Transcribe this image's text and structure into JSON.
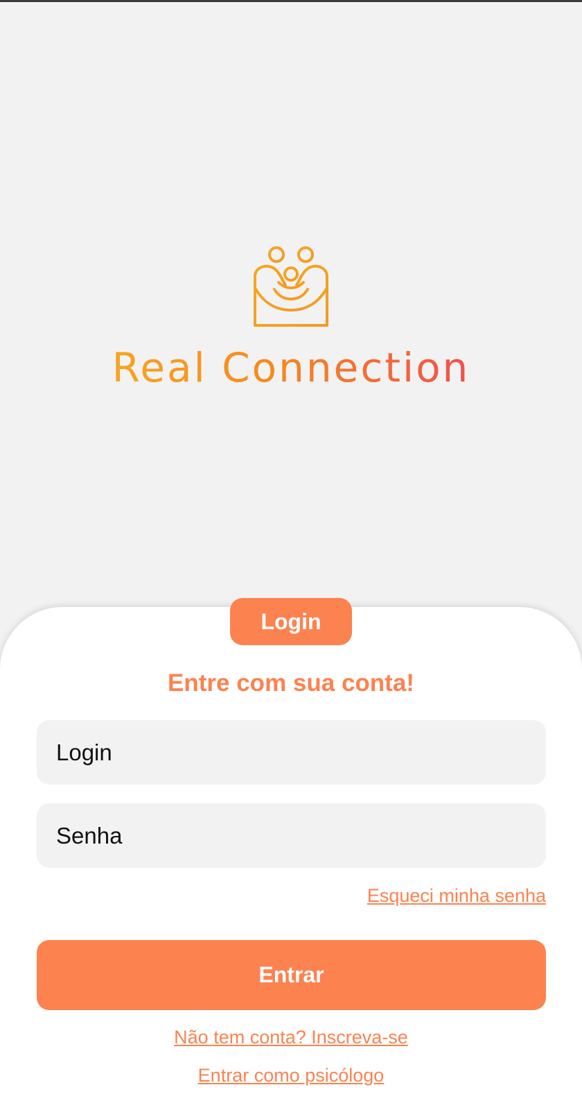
{
  "brand": {
    "name": "Real Connection",
    "logo_icon": "family-embrace-icon",
    "gradient_start": "#F5A623",
    "gradient_end": "#F0504F"
  },
  "login_sheet": {
    "tab_label": "Login",
    "title": "Entre com sua conta!",
    "login_field": {
      "placeholder": "Login",
      "value": ""
    },
    "password_field": {
      "placeholder": "Senha",
      "value": ""
    },
    "forgot_password_label": "Esqueci minha senha",
    "submit_label": "Entrar",
    "signup_label": "Não tem conta? Inscreva-se",
    "psychologist_label": "Entrar como psicólogo"
  },
  "colors": {
    "accent": "#FC8250",
    "background": "#F2F2F2",
    "sheet": "#FFFFFF",
    "field": "#F2F2F2"
  }
}
